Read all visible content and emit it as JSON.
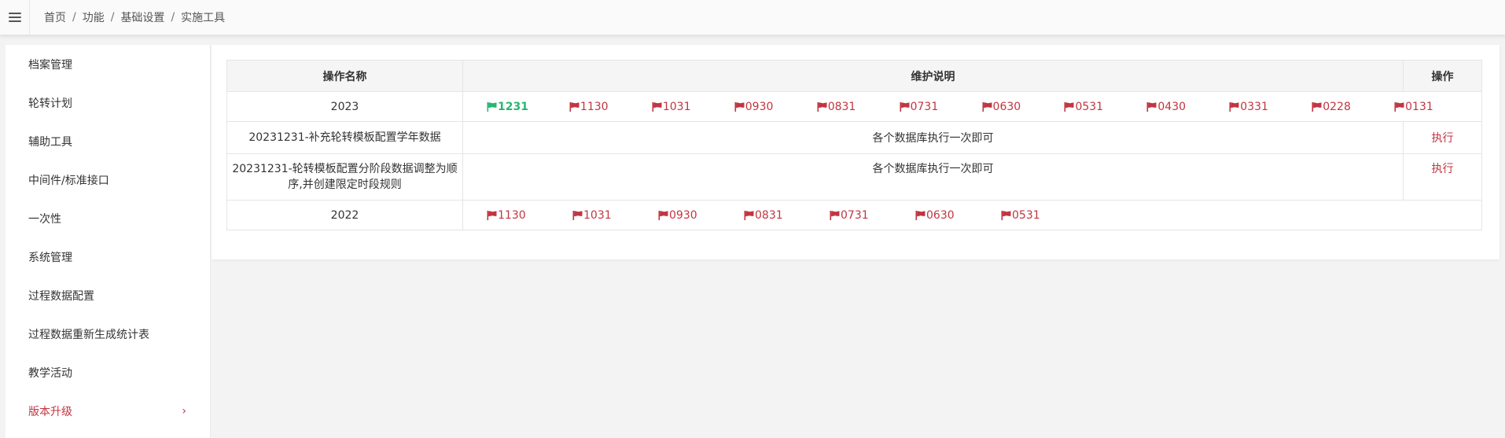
{
  "breadcrumb": {
    "items": [
      "首页",
      "功能",
      "基础设置",
      "实施工具"
    ],
    "separator": "/"
  },
  "sidebar": {
    "items": [
      {
        "label": "档案管理"
      },
      {
        "label": "轮转计划"
      },
      {
        "label": "辅助工具"
      },
      {
        "label": "中间件/标准接口"
      },
      {
        "label": "一次性"
      },
      {
        "label": "系统管理"
      },
      {
        "label": "过程数据配置"
      },
      {
        "label": "过程数据重新生成统计表"
      },
      {
        "label": "教学活动"
      },
      {
        "label": "版本升级",
        "active": true,
        "chevron": "›"
      }
    ]
  },
  "table": {
    "headers": {
      "name": "操作名称",
      "desc": "维护说明",
      "action": "操作"
    },
    "rows": [
      {
        "name": "2023",
        "flags": [
          "1231",
          "1130",
          "1031",
          "0930",
          "0831",
          "0731",
          "0630",
          "0531",
          "0430",
          "0331",
          "0228",
          "0131"
        ],
        "current": "1231"
      },
      {
        "name": "20231231-补充轮转模板配置学年数据",
        "desc": "各个数据库执行一次即可",
        "action": "执行"
      },
      {
        "name": "20231231-轮转模板配置分阶段数据调整为顺序,并创建限定时段规则",
        "desc": "各个数据库执行一次即可",
        "action": "执行"
      },
      {
        "name": "2022",
        "flags": [
          "1130",
          "1031",
          "0930",
          "0831",
          "0731",
          "0630",
          "0531"
        ]
      }
    ]
  },
  "colors": {
    "accent": "#c13541",
    "current": "#27b772"
  },
  "icons": {
    "menu": "hamburger-icon",
    "flag": "flag-icon",
    "chevron": "chevron-right-icon"
  }
}
